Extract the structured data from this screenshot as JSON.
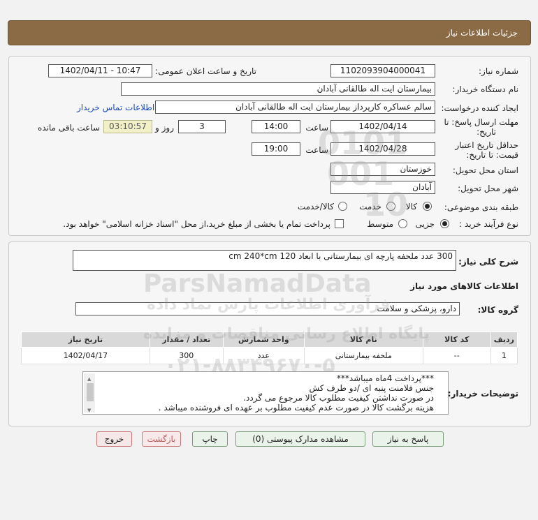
{
  "header": {
    "title": "جزئیات اطلاعات نیاز"
  },
  "form": {
    "need_number_label": "شماره نیاز:",
    "need_number": "1102093904000041",
    "announce_label": "تاریخ و ساعت اعلان عمومی:",
    "announce_value": "1402/04/11 - 10:47",
    "buyer_org_label": "نام دستگاه خریدار:",
    "buyer_org": "بیمارستان ایت اله طالقانی آبادان",
    "creator_label": "ایجاد کننده درخواست:",
    "creator": "سالم عساکره کارپرداز بیمارستان ایت اله طالقانی آبادان",
    "contact_link": "اطلاعات تماس خریدار",
    "deadline_label_1": "مهلت ارسال پاسخ: تا",
    "deadline_label_2": "تاریخ:",
    "deadline_date": "1402/04/14",
    "time_label": "ساعت",
    "deadline_time": "14:00",
    "days_value": "3",
    "days_label": "روز و",
    "remaining_time": "03:10:57",
    "remaining_label": "ساعت باقی مانده",
    "validity_label_1": "حداقل تاریخ اعتبار",
    "validity_label_2": "قیمت: تا تاریخ:",
    "validity_date": "1402/04/28",
    "validity_time_label": "ساعت",
    "validity_time": "19:00",
    "province_label": "استان محل تحویل:",
    "province": "خوزستان",
    "city_label": "شهر محل تحویل:",
    "city": "آبادان",
    "category_label": "طبقه بندی موضوعی:",
    "category_options": [
      "کالا",
      "خدمت",
      "کالا/خدمت"
    ],
    "process_label": "نوع فرآیند خرید :",
    "process_options": [
      "جزیی",
      "متوسط"
    ],
    "payment_note": "پرداخت تمام یا بخشی از مبلغ خرید،از محل \"اسناد خزانه اسلامی\" خواهد بود."
  },
  "summary": {
    "label": "شرح کلی نیاز:",
    "value": "300 عدد ملحفه پارچه ای بیمارستانی با ابعاد 120 cm 240*cm",
    "goods_info_title": "اطلاعات کالاهای مورد نیاز",
    "group_label": "گروه کالا:",
    "group_value": "دارو، پزشکی و سلامت"
  },
  "table": {
    "headers": [
      "ردیف",
      "کد کالا",
      "نام کالا",
      "واحد شمارش",
      "تعداد / مقدار",
      "تاریخ نیاز"
    ],
    "rows": [
      [
        "1",
        "--",
        "ملحفه بیمارستانی",
        "عدد",
        "300",
        "1402/04/17"
      ]
    ]
  },
  "buyer_notes": {
    "label": "توضیحات خریدار:",
    "lines": [
      "***پرداخت 4ماه میباشد***",
      "جنس فلامنت پنبه ای /دو طرف کش",
      "در صورت نداشتن کیفیت مطلوب کالا مرجوع می گردد.",
      "هزینه برگشت کالا در صورت عدم کیفیت مطلوب بر عهده ای فروشنده میباشد ."
    ]
  },
  "buttons": {
    "reply": "پاسخ به نیاز",
    "attachments": "مشاهده مدارک پیوستی (0)",
    "print": "چاپ",
    "back": "بازگشت",
    "exit": "خروج"
  },
  "watermark": {
    "brand": "ParsNamadData",
    "line1": "پایگاه اطلاع رسانی مناقصات و مزایده",
    "line2": "فرآوری اطلاعات پارس نماد داده",
    "phone": "۰۲۱-۸۸۳۴۹۶۷۰-۵",
    "digits1": "0101",
    "digits2": "001",
    "digits3": "10"
  },
  "colors": {
    "header_bg": "#8b6b45",
    "link": "#1c48b8",
    "remaining_bg": "#f1f0c8",
    "button_green": "#eaf3ea",
    "button_red": "#f6e8e8"
  }
}
